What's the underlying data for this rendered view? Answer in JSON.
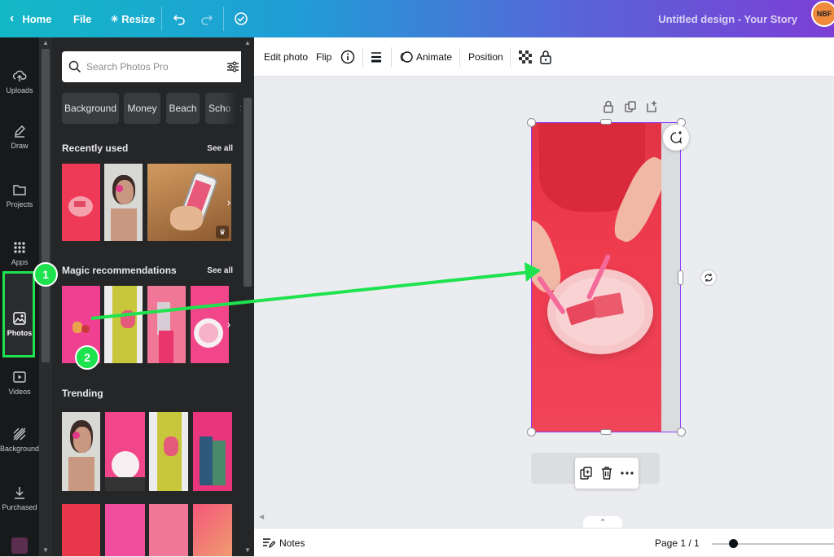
{
  "topbar": {
    "home_label": "Home",
    "file_label": "File",
    "resize_label": "Resize",
    "design_title": "Untitled design - Your Story",
    "avatar_text": "NBF",
    "gradient_colors": [
      "#13b8c6",
      "#7c3fd6"
    ]
  },
  "rail": {
    "items": [
      {
        "label": "Uploads",
        "icon": "cloud-upload-icon"
      },
      {
        "label": "Draw",
        "icon": "pen-icon"
      },
      {
        "label": "Projects",
        "icon": "folder-icon"
      },
      {
        "label": "Apps",
        "icon": "grid-icon"
      },
      {
        "label": "Photos",
        "icon": "image-icon"
      },
      {
        "label": "Videos",
        "icon": "play-icon"
      },
      {
        "label": "Background",
        "icon": "hatch-icon"
      },
      {
        "label": "Purchased",
        "icon": "download-icon"
      }
    ],
    "active": "Photos",
    "highlight_color": "#1fe34e"
  },
  "panel": {
    "search_placeholder": "Search Photos Pro",
    "chips": [
      "Background",
      "Money",
      "Beach",
      "Scho"
    ],
    "recently_used_title": "Recently used",
    "magic_title": "Magic recommendations",
    "trending_title": "Trending",
    "see_all": "See all"
  },
  "toolbar": {
    "edit_photo": "Edit photo",
    "flip": "Flip",
    "animate": "Animate",
    "position": "Position"
  },
  "bottombar": {
    "notes": "Notes",
    "page": "Page 1 / 1"
  },
  "annotations": {
    "step1": "1",
    "step2": "2",
    "arrow_color": "#1fe34e"
  },
  "accent": "#8b3dff"
}
